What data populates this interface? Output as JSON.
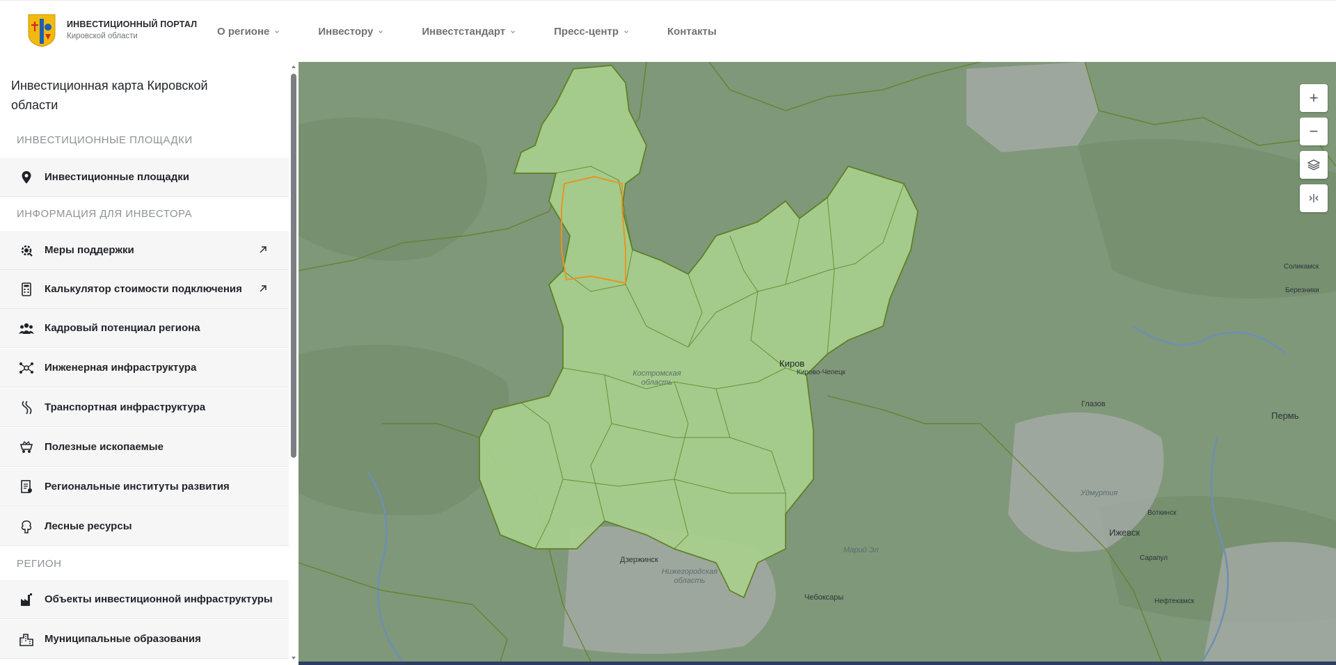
{
  "header": {
    "brand_title": "ИНВЕСТИЦИОННЫЙ ПОРТАЛ",
    "brand_subtitle": "Кировской области",
    "nav": [
      {
        "label": "О регионе",
        "has_dropdown": true
      },
      {
        "label": "Инвестору",
        "has_dropdown": true
      },
      {
        "label": "Инвестстандарт",
        "has_dropdown": true
      },
      {
        "label": "Пресс-центр",
        "has_dropdown": true
      },
      {
        "label": "Контакты",
        "has_dropdown": false
      }
    ]
  },
  "sidebar": {
    "title": "Инвестиционная карта Кировской области",
    "sections": [
      {
        "label": "ИНВЕСТИЦИОННЫЕ ПЛОЩАДКИ"
      },
      {
        "label": "ИНФОРМАЦИЯ ДЛЯ ИНВЕСТОРА"
      },
      {
        "label": "РЕГИОН"
      }
    ],
    "items": [
      {
        "label": "Инвестиционные площадки",
        "icon": "map-pin-icon",
        "external": false
      },
      {
        "label": "Меры поддержки",
        "icon": "support-gear-icon",
        "external": true
      },
      {
        "label": "Калькулятор стоимости подключения",
        "icon": "calculator-icon",
        "external": true
      },
      {
        "label": "Кадровый потенциал региона",
        "icon": "people-icon",
        "external": false
      },
      {
        "label": "Инженерная инфраструктура",
        "icon": "network-icon",
        "external": false
      },
      {
        "label": "Транспортная инфраструктура",
        "icon": "road-icon",
        "external": false
      },
      {
        "label": "Полезные ископаемые",
        "icon": "mining-cart-icon",
        "external": false
      },
      {
        "label": "Региональные институты развития",
        "icon": "document-icon",
        "external": false
      },
      {
        "label": "Лесные ресурсы",
        "icon": "tree-icon",
        "external": false
      },
      {
        "label": "Объекты инвестиционной инфраструктуры",
        "icon": "factory-icon",
        "external": false
      },
      {
        "label": "Муниципальные образования",
        "icon": "city-icon",
        "external": false
      }
    ]
  },
  "map": {
    "controls": [
      {
        "symbol": "+",
        "name": "zoom-in"
      },
      {
        "symbol": "−",
        "name": "zoom-out"
      },
      {
        "symbol": "",
        "name": "layers"
      },
      {
        "symbol": "",
        "name": "collapse"
      }
    ],
    "cities": [
      "Киров",
      "Кирово-Чепецк",
      "Глазов",
      "Пермь",
      "Соликамск",
      "Березники",
      "Ижевск",
      "Воткинск",
      "Сарапул",
      "Чебоксары",
      "Дзержинск",
      "Нефтекамск"
    ],
    "regions": [
      "Костромская область",
      "Удмуртия",
      "Марий Эл",
      "Нижегородская область"
    ],
    "colors": {
      "highlight": "#a8d08d",
      "border": "#5b7f1e",
      "selected": "#e8941f",
      "base": "#7f9879"
    }
  }
}
